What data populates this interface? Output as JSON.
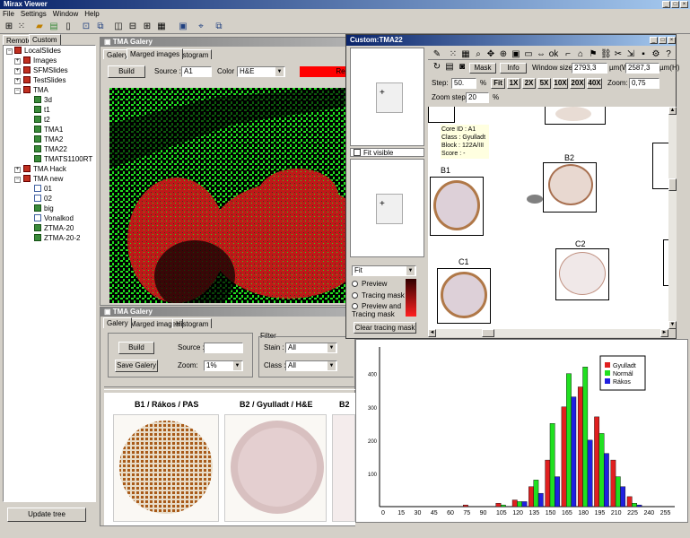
{
  "app": {
    "title": "Mirax Viewer",
    "menu": [
      "File",
      "Settings",
      "Window",
      "Help"
    ],
    "window_controls": [
      "_",
      "□",
      "×"
    ]
  },
  "left": {
    "tabs": [
      "Remote",
      "Custom"
    ],
    "update_label": "Update tree",
    "tree": [
      "LocalSlides",
      "Images",
      "SFMSlides",
      "TestSlides",
      "TMA",
      "3d",
      "t1",
      "t2",
      "TMA1",
      "TMA2",
      "TMA22",
      "TMATS1100RT",
      "TMA Hack",
      "TMA new",
      "01",
      "02",
      "big",
      "Vonalkod",
      "ZTMA-20",
      "ZTMA-20-2"
    ]
  },
  "gallery1": {
    "title": "TMA Galery",
    "tabs": [
      "Galery",
      "Marged images",
      "Histogram"
    ],
    "build_label": "Build",
    "source_label": "Source :",
    "source_value": "A1",
    "color_label": "Color :",
    "color_value": "H&E",
    "red_label": "Red"
  },
  "gallery2": {
    "title": "TMA Galery",
    "tabs": [
      "Galery",
      "Marged images",
      "Histogram"
    ],
    "build_label": "Build",
    "save_label": "Save Galery",
    "source_label": "Source :",
    "source_value": "",
    "zoom_label": "Zoom:",
    "zoom_value": "1%",
    "filter_label": "Filter",
    "stain_label": "Stain :",
    "stain_value": "All",
    "class_label": "Class :",
    "class_value": "All",
    "thumbs": [
      "B1 / Rákos / PAS",
      "B2 / Gyulladt / H&E",
      "B2"
    ]
  },
  "custom": {
    "title": "Custom:TMA22",
    "fit_visible": "Fit visible",
    "fit_select": "Fit",
    "radio": [
      "Preview",
      "Tracing mask",
      "Preview and Tracing mask"
    ],
    "clear_label": "Clear tracing mask",
    "mask_label": "Mask",
    "info_label": "Info",
    "window_size_label": "Window size:",
    "window_w": "2793,3",
    "window_h": "2587,3",
    "unit_w": "µm(W)",
    "unit_h": "µm(H)",
    "step_label": "Step:",
    "step_value": "50.",
    "percent": "%",
    "zoom_buttons": [
      "Fit",
      "1X",
      "2X",
      "5X",
      "10X",
      "20X",
      "40X"
    ],
    "zoom_label": "Zoom:",
    "zoom_value": "0,75",
    "zoom_step_label": "Zoom step:",
    "zoom_step_value": "20",
    "tooltip": [
      "Core ID : A1",
      "Class : Gyulladt",
      "Block : 122A/III",
      "Score : -"
    ],
    "cores": [
      "B1",
      "B2",
      "C1",
      "C2"
    ]
  },
  "chart_data": {
    "type": "bar",
    "x": [
      0,
      15,
      30,
      45,
      60,
      75,
      90,
      105,
      120,
      135,
      150,
      165,
      180,
      195,
      210,
      225,
      240,
      255
    ],
    "tick_labels": [
      "0",
      "15",
      "30",
      "45",
      "60",
      "75",
      "90",
      "105",
      "120",
      "135",
      "150",
      "165",
      "180",
      "195",
      "210",
      "225",
      "240",
      "255"
    ],
    "y_ticks": [
      "100",
      "200",
      "300",
      "400"
    ],
    "ylim": [
      0,
      480
    ],
    "series": [
      {
        "name": "Gyulladt",
        "color": "#e02020",
        "values": [
          0,
          0,
          0,
          0,
          0,
          5,
          0,
          10,
          20,
          60,
          140,
          300,
          360,
          270,
          140,
          30,
          0,
          0
        ]
      },
      {
        "name": "Normál",
        "color": "#20e020",
        "values": [
          0,
          0,
          0,
          0,
          0,
          0,
          0,
          5,
          15,
          80,
          250,
          400,
          420,
          220,
          90,
          10,
          0,
          0
        ]
      },
      {
        "name": "Rákos",
        "color": "#2020e0",
        "values": [
          0,
          0,
          0,
          0,
          0,
          0,
          0,
          0,
          15,
          40,
          90,
          330,
          200,
          160,
          60,
          5,
          0,
          0
        ]
      }
    ]
  }
}
